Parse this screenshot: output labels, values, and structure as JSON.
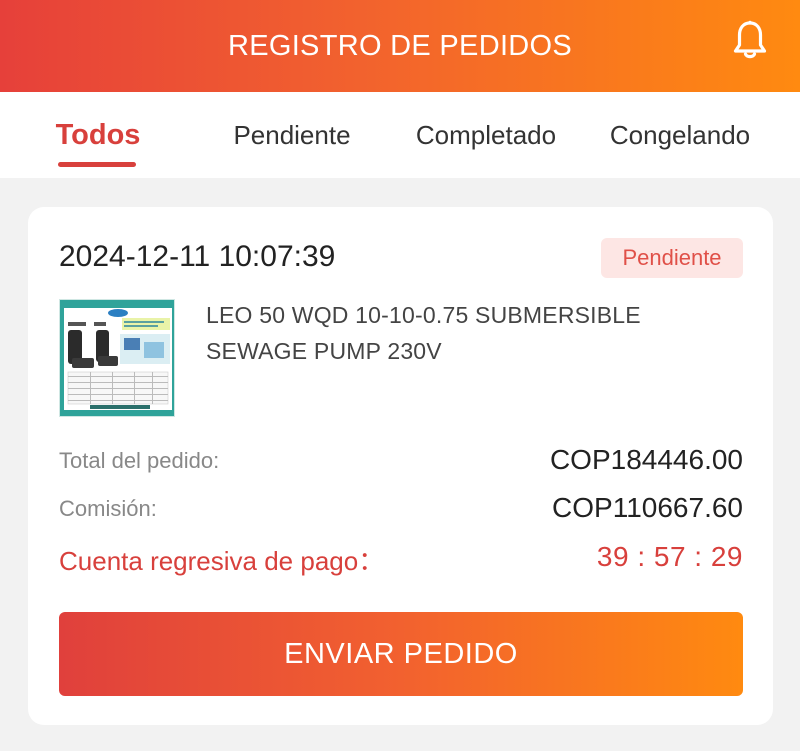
{
  "header": {
    "title": "REGISTRO DE PEDIDOS",
    "notification_icon": "bell-icon",
    "gradient_start": "#e6403a",
    "gradient_end": "#ff8a10"
  },
  "tabs": [
    {
      "label": "Todos",
      "active": true
    },
    {
      "label": "Pendiente",
      "active": false
    },
    {
      "label": "Completado",
      "active": false
    },
    {
      "label": "Congelando",
      "active": false
    }
  ],
  "order": {
    "date": "2024-12-11 10:07:39",
    "status": "Pendiente",
    "product_name": "LEO 50 WQD 10-10-0.75 SUBMERSIBLE SEWAGE PUMP 230V",
    "total_label": "Total del pedido:",
    "total_value": "COP184446.00",
    "commission_label": "Comisión:",
    "commission_value": "COP110667.60",
    "countdown_label": "Cuenta regresiva de pago：",
    "countdown_value": "39 : 57 : 29",
    "submit_label": "ENVIAR PEDIDO"
  },
  "colors": {
    "accent": "#d8403c",
    "badge_bg": "#fde6e4",
    "page_bg": "#f2f2f2"
  }
}
